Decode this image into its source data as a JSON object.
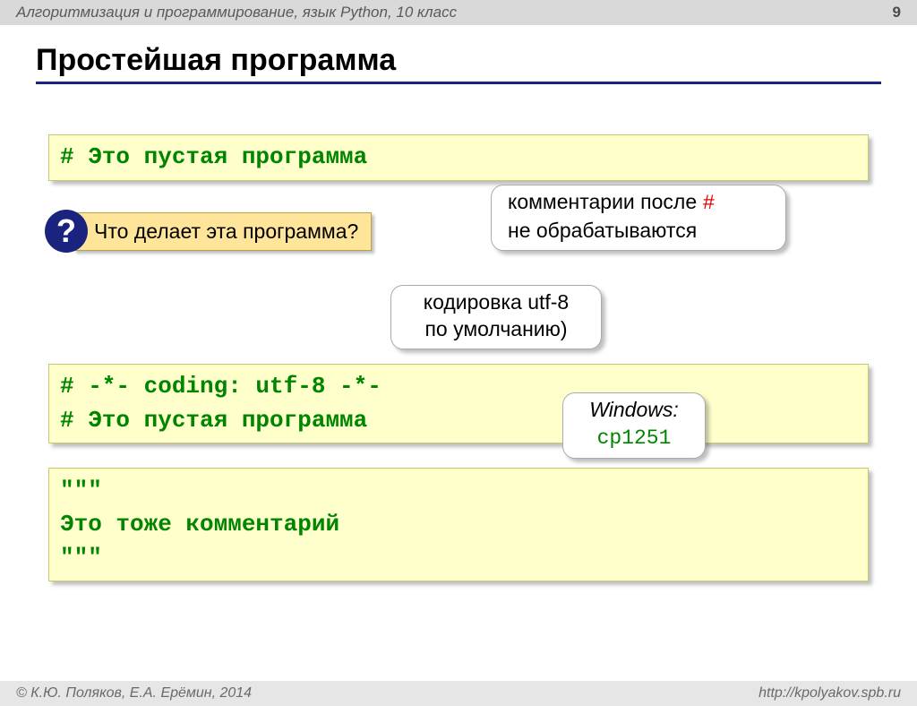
{
  "header": {
    "course": "Алгоритмизация и программирование, язык Python, 10 класс",
    "page": "9"
  },
  "title": "Простейшая программа",
  "code1": {
    "line1": "# Это пустая программа"
  },
  "question": {
    "mark": "?",
    "text": "Что делает эта программа?"
  },
  "note_hash": {
    "l1a": "комментарии после ",
    "l1b": "#",
    "l2": "не обрабатываются"
  },
  "note_utf": {
    "l1": "кодировка utf-8",
    "l2": "по умолчанию)"
  },
  "code2": {
    "line1": "# -*- coding: utf-8 -*-",
    "line2": "# Это пустая программа"
  },
  "note_win": {
    "l1": "Windows:",
    "l2": "cp1251"
  },
  "code3": {
    "line1": "\"\"\"",
    "line2": "Это тоже комментарий",
    "line3": "\"\"\""
  },
  "footer": {
    "authors": "© К.Ю. Поляков, Е.А. Ерёмин, 2014",
    "url": "http://kpolyakov.spb.ru"
  }
}
